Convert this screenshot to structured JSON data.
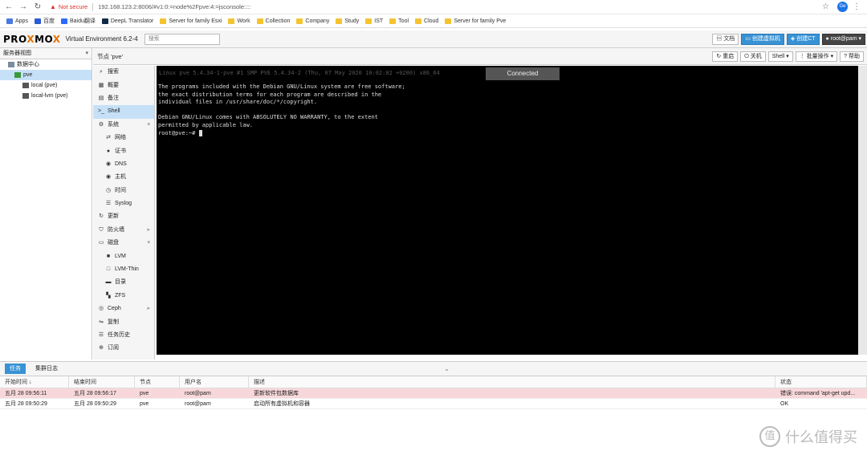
{
  "browser": {
    "not_secure": "Not secure",
    "url": "192.168.123.2:8006/#v1:0:=node%2Fpve:4:=jsconsole::::",
    "profile": "Ge",
    "bookmarks": [
      "Apps",
      "百度",
      "Baidu翻译",
      "DeepL Translator",
      "Server for family Esxi",
      "Work",
      "Collection",
      "Company",
      "Study",
      "IST",
      "Tool",
      "Cloud",
      "Server for family Pve"
    ]
  },
  "header": {
    "logo_a": "PRO",
    "logo_x": "X",
    "logo_b": "MO",
    "logo_x2": "X",
    "version": "Virtual Environment 6.2-4",
    "search_placeholder": "搜索",
    "docs": "文档",
    "create_vm": "创建虚拟机",
    "create_ct": "创建CT",
    "user": "root@pam"
  },
  "tree": {
    "view": "服务器视图",
    "items": [
      "数据中心",
      "pve",
      "local (pve)",
      "local-lvm (pve)"
    ]
  },
  "node": {
    "title": "节点 'pve'",
    "restart": "重启",
    "shutdown": "关机",
    "shell": "Shell",
    "bulk": "批量操作",
    "help": "帮助"
  },
  "menu": {
    "items": [
      "搜索",
      "概要",
      "备注",
      "Shell",
      "系统",
      "网络",
      "证书",
      "DNS",
      "主机",
      "时间",
      "Syslog",
      "更新",
      "防火墙",
      "磁盘",
      "LVM",
      "LVM-Thin",
      "目录",
      "ZFS",
      "Ceph",
      "复制",
      "任务历史",
      "订阅"
    ]
  },
  "terminal": {
    "top_line": "Linux pve 5.4.34-1-pve #1 SMP PVE 5.4.34-2 (Thu, 07 May 2020 10:02:02 +0200) x86_64",
    "connected": "Connected",
    "lines": [
      "The programs included with the Debian GNU/Linux system are free software;",
      "the exact distribution terms for each program are described in the",
      "individual files in /usr/share/doc/*/copyright.",
      "",
      "Debian GNU/Linux comes with ABSOLUTELY NO WARRANTY, to the extent",
      "permitted by applicable law.",
      "root@pve:~# "
    ]
  },
  "tasks": {
    "tab_tasks": "任务",
    "tab_log": "集群日志",
    "columns": [
      "开始时间 ↓",
      "结束时间",
      "节点",
      "用户名",
      "描述",
      "状态"
    ],
    "rows": [
      {
        "start": "五月 28 09:56:11",
        "end": "五月 28 09:56:17",
        "node": "pve",
        "user": "root@pam",
        "desc": "更新软件包数据库",
        "status": "错误: command 'apt-get upd..."
      },
      {
        "start": "五月 28 09:50:29",
        "end": "五月 28 09:50:29",
        "node": "pve",
        "user": "root@pam",
        "desc": "启动所有虚拟机和容器",
        "status": "OK"
      }
    ]
  },
  "watermark": "什么值得买",
  "watermark_icon": "值"
}
